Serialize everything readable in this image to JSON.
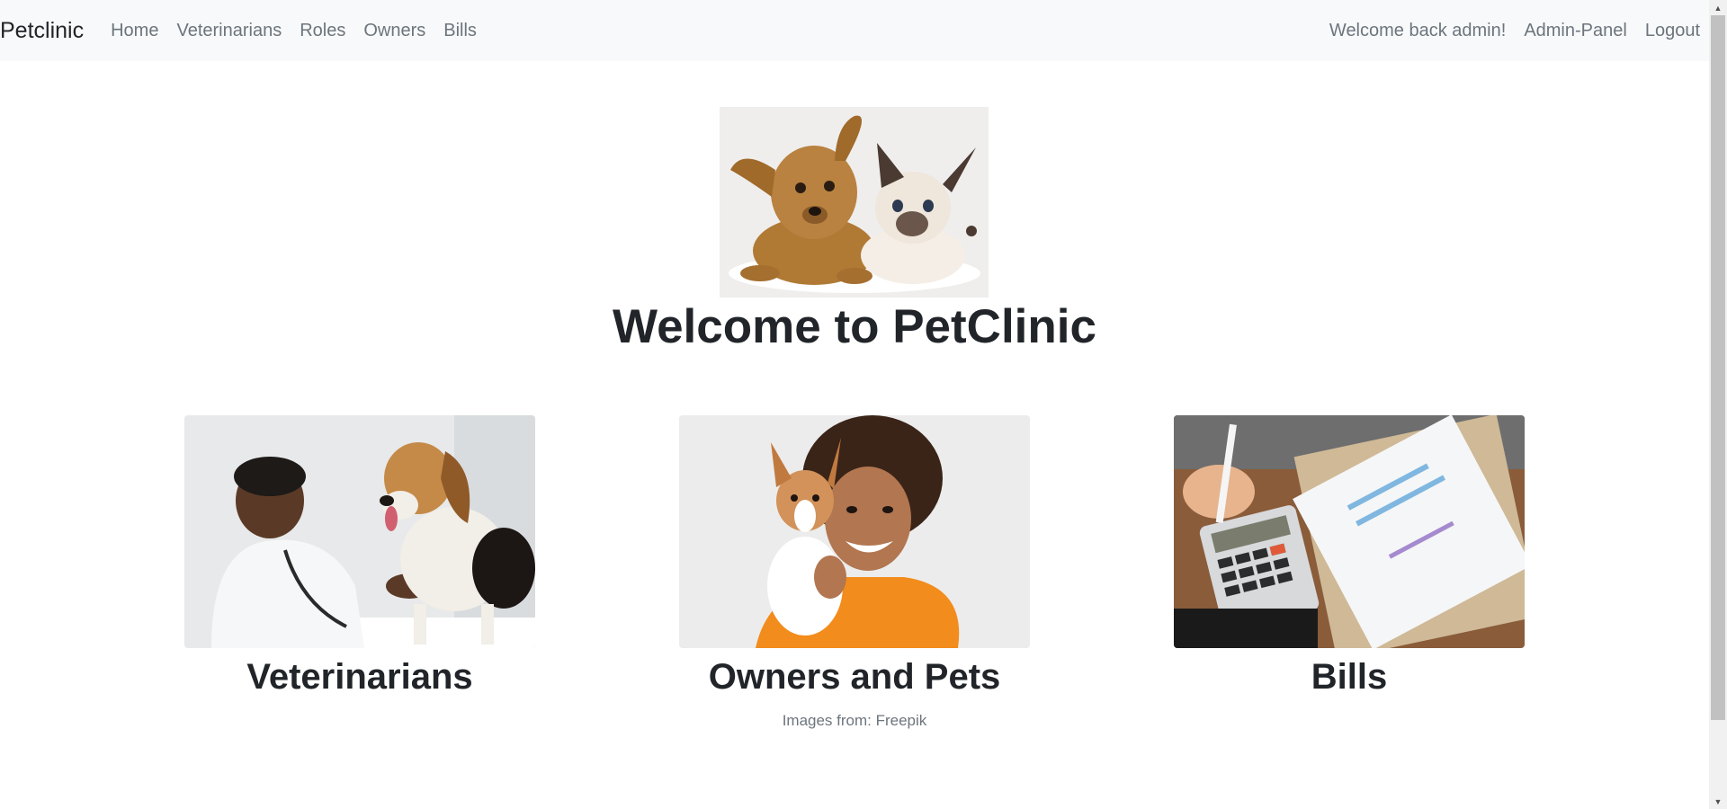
{
  "navbar": {
    "brand": "Petclinic",
    "links": [
      "Home",
      "Veterinarians",
      "Roles",
      "Owners",
      "Bills"
    ],
    "welcome": "Welcome back admin!",
    "admin_panel": "Admin-Panel",
    "logout": "Logout"
  },
  "hero": {
    "title": "Welcome to PetClinic"
  },
  "cards": [
    {
      "title": "Veterinarians"
    },
    {
      "title": "Owners and Pets"
    },
    {
      "title": "Bills"
    }
  ],
  "footer": {
    "credits": "Images from: Freepik"
  },
  "colors": {
    "navbar_bg": "#f8f9fa",
    "link": "#6c757d",
    "text": "#212529"
  }
}
